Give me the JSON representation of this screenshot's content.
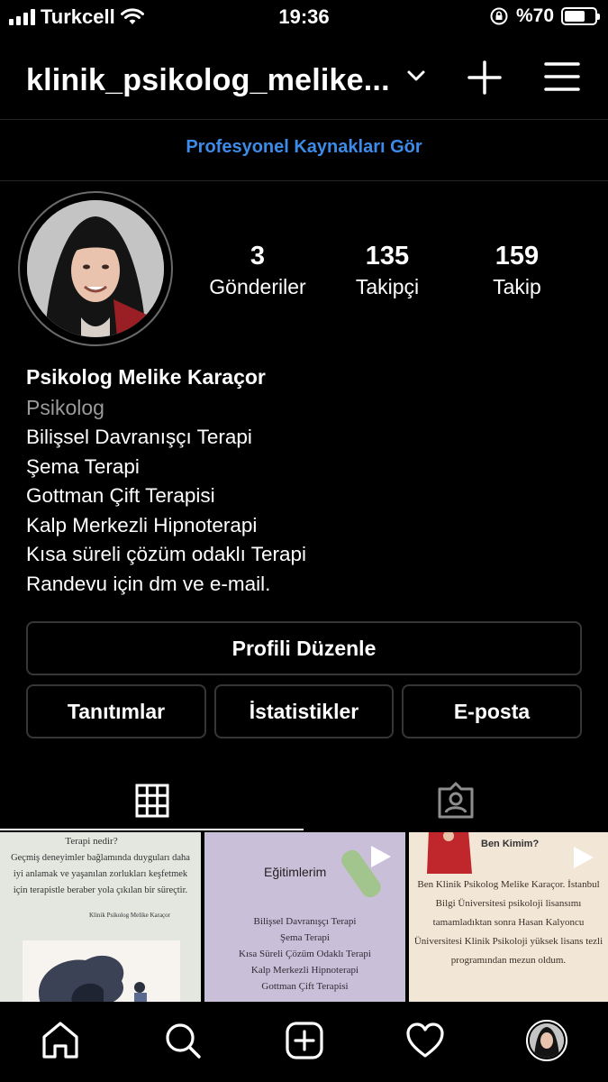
{
  "status_bar": {
    "carrier": "Turkcell",
    "time": "19:36",
    "battery": "%70",
    "battery_level": 0.7
  },
  "header": {
    "username": "klinik_psikolog_melike...",
    "icons": [
      "chevron-down-icon",
      "plus-icon",
      "menu-icon"
    ]
  },
  "pro_link": "Profesyonel Kaynakları Gör",
  "stats": [
    {
      "value": "3",
      "label": "Gönderiler"
    },
    {
      "value": "135",
      "label": "Takipçi"
    },
    {
      "value": "159",
      "label": "Takip"
    }
  ],
  "bio": {
    "name": "Psikolog Melike Karaçor",
    "category": "Psikolog",
    "lines": [
      "Bilişsel Davranışçı Terapi",
      "Şema Terapi",
      "Gottman Çift Terapisi",
      "Kalp Merkezli Hipnoterapi",
      "Kısa süreli çözüm odaklı Terapi",
      "Randevu için dm ve e-mail."
    ]
  },
  "buttons": {
    "edit_profile": "Profili Düzenle",
    "promotions": "Tanıtımlar",
    "insights": "İstatistikler",
    "email": "E-posta"
  },
  "tabs": [
    "grid-icon",
    "tagged-icon"
  ],
  "posts": [
    {
      "title": "Terapi nedir?",
      "text": "Geçmiş deneyimler bağlamında duyguları daha iyi anlamak ve yaşanılan zorlukları keşfetmek için terapistle beraber yola çıkılan bir süreçtir.",
      "signature": "Klinik Psikolog Melike Karaçor"
    },
    {
      "title": "Eğitimlerim",
      "items": [
        "Bilişsel Davranışçı Terapi",
        "Şema Terapi",
        "Kısa Süreli Çözüm Odaklı Terapi",
        "Kalp Merkezli Hipnoterapi",
        "Gottman Çift Terapisi"
      ]
    },
    {
      "title": "Ben Kimim?",
      "text": "Ben Klinik Psikolog Melike Karaçor. İstanbul Bilgi Üniversitesi psikoloji lisansımı tamamladıktan sonra Hasan Kalyoncu Üniversitesi Klinik Psikoloji yüksek lisans tezli programından mezun oldum."
    }
  ],
  "bottom_nav": [
    "home-icon",
    "search-icon",
    "new-post-icon",
    "activity-icon",
    "profile-avatar"
  ]
}
